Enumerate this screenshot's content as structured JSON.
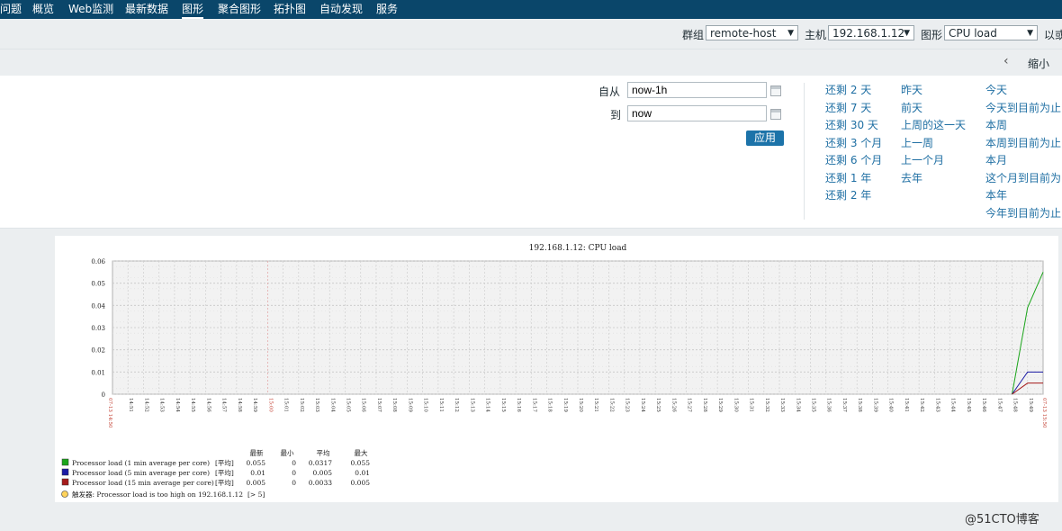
{
  "nav": {
    "items": [
      {
        "label": "问题"
      },
      {
        "label": "概览"
      },
      {
        "label": "Web监测"
      },
      {
        "label": "最新数据"
      },
      {
        "label": "图形"
      },
      {
        "label": "聚合图形"
      },
      {
        "label": "拓扑图"
      },
      {
        "label": "自动发现"
      },
      {
        "label": "服务"
      }
    ],
    "active": "图形"
  },
  "filters": {
    "group_label": "群组",
    "group_value": "remote-host",
    "host_label": "主机",
    "host_value": "192.168.1.12",
    "graph_label": "图形",
    "graph_value": "CPU load",
    "extra_label": "以或"
  },
  "subbar": {
    "zoom_out": "缩小"
  },
  "timeframe": {
    "from_label": "自从",
    "from_value": "now-1h",
    "to_label": "到",
    "to_value": "now",
    "apply": "应用"
  },
  "quick": {
    "col1": [
      "还剩 2 天",
      "还剩 7 天",
      "还剩 30 天",
      "还剩 3 个月",
      "还剩 6 个月",
      "还剩 1 年",
      "还剩 2 年"
    ],
    "col2": [
      "昨天",
      "前天",
      "上周的这一天",
      "上一周",
      "上一个月",
      "去年"
    ],
    "col3": [
      "今天",
      "今天到目前为止",
      "本周",
      "本周到目前为止",
      "本月",
      "这个月到目前为",
      "本年",
      "今年到目前为止"
    ]
  },
  "chart_data": {
    "type": "line",
    "title": "192.168.1.12: CPU load",
    "ylim": [
      0,
      0.06
    ],
    "yticks": [
      "0.06",
      "0.05",
      "0.04",
      "0.03",
      "0.02",
      "0.01",
      "0"
    ],
    "x_first_label": "07-13 14:50",
    "x_last_label": "07-13 15:50",
    "xticks": [
      "14:51",
      "14:52",
      "14:53",
      "14:54",
      "14:55",
      "14:56",
      "14:57",
      "14:58",
      "14:59",
      "15:00",
      "15:01",
      "15:02",
      "15:03",
      "15:04",
      "15:05",
      "15:06",
      "15:07",
      "15:08",
      "15:09",
      "15:10",
      "15:11",
      "15:12",
      "15:13",
      "15:14",
      "15:15",
      "15:16",
      "15:17",
      "15:18",
      "15:19",
      "15:20",
      "15:21",
      "15:22",
      "15:23",
      "15:24",
      "15:25",
      "15:26",
      "15:27",
      "15:28",
      "15:29",
      "15:30",
      "15:31",
      "15:32",
      "15:33",
      "15:34",
      "15:35",
      "15:36",
      "15:37",
      "15:38",
      "15:39",
      "15:40",
      "15:41",
      "15:42",
      "15:43",
      "15:44",
      "15:45",
      "15:46",
      "15:47",
      "15:48",
      "15:49"
    ],
    "highlight_tick": "15:00",
    "x_minutes": [
      58,
      59,
      60
    ],
    "series": [
      {
        "name": "Processor load (1 min average per core)",
        "color": "#1aa51a",
        "values": [
          0,
          0.039,
          0.055
        ]
      },
      {
        "name": "Processor load (5 min average per core)",
        "color": "#1a1aa5",
        "values": [
          0,
          0.01,
          0.01
        ]
      },
      {
        "name": "Processor load (15 min average per core)",
        "color": "#a51a1a",
        "values": [
          0,
          0.005,
          0.005
        ]
      }
    ],
    "grid": true
  },
  "legend": {
    "headers": [
      "最新",
      "最小",
      "平均",
      "最大"
    ],
    "rows": [
      {
        "name": "Processor load (1 min average per core)",
        "func": "[平均]",
        "color": "#1aa51a",
        "last": "0.055",
        "min": "0",
        "avg": "0.0317",
        "max": "0.055"
      },
      {
        "name": "Processor load (5 min average per core)",
        "func": "[平均]",
        "color": "#1a1aa5",
        "last": "0.01",
        "min": "0",
        "avg": "0.005",
        "max": "0.01"
      },
      {
        "name": "Processor load (15 min average per core)",
        "func": "[平均]",
        "color": "#a51a1a",
        "last": "0.005",
        "min": "0",
        "avg": "0.0033",
        "max": "0.005"
      }
    ],
    "trigger_label": "触发器",
    "trigger_text": ": Processor load is too high on 192.168.1.12",
    "trigger_value": "[> 5]"
  },
  "watermark": "@51CTO博客"
}
